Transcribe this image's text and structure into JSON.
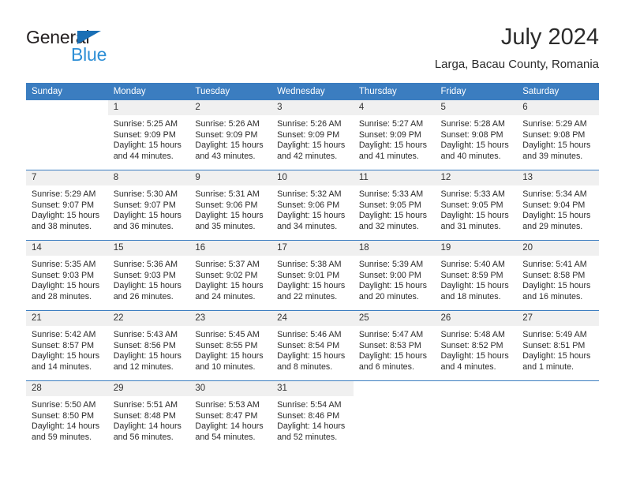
{
  "brand": {
    "word_one": "General",
    "word_two": "Blue",
    "triangle_icon": "brand-triangle-icon",
    "accent_dark": "#1a6fb5",
    "accent_light": "#2e8fd6"
  },
  "header": {
    "title": "July 2024",
    "subtitle": "Larga, Bacau County, Romania"
  },
  "colors": {
    "header_blue": "#3b7dc0",
    "daynum_band": "#f0f0f0",
    "text": "#2b2b2b"
  },
  "weekdays": [
    "Sunday",
    "Monday",
    "Tuesday",
    "Wednesday",
    "Thursday",
    "Friday",
    "Saturday"
  ],
  "weeks": [
    [
      {
        "day": "",
        "empty": true,
        "sunrise": "",
        "sunset": "",
        "daylight_line1": "",
        "daylight_line2": ""
      },
      {
        "day": "1",
        "sunrise": "Sunrise: 5:25 AM",
        "sunset": "Sunset: 9:09 PM",
        "daylight_line1": "Daylight: 15 hours",
        "daylight_line2": "and 44 minutes."
      },
      {
        "day": "2",
        "sunrise": "Sunrise: 5:26 AM",
        "sunset": "Sunset: 9:09 PM",
        "daylight_line1": "Daylight: 15 hours",
        "daylight_line2": "and 43 minutes."
      },
      {
        "day": "3",
        "sunrise": "Sunrise: 5:26 AM",
        "sunset": "Sunset: 9:09 PM",
        "daylight_line1": "Daylight: 15 hours",
        "daylight_line2": "and 42 minutes."
      },
      {
        "day": "4",
        "sunrise": "Sunrise: 5:27 AM",
        "sunset": "Sunset: 9:09 PM",
        "daylight_line1": "Daylight: 15 hours",
        "daylight_line2": "and 41 minutes."
      },
      {
        "day": "5",
        "sunrise": "Sunrise: 5:28 AM",
        "sunset": "Sunset: 9:08 PM",
        "daylight_line1": "Daylight: 15 hours",
        "daylight_line2": "and 40 minutes."
      },
      {
        "day": "6",
        "sunrise": "Sunrise: 5:29 AM",
        "sunset": "Sunset: 9:08 PM",
        "daylight_line1": "Daylight: 15 hours",
        "daylight_line2": "and 39 minutes."
      }
    ],
    [
      {
        "day": "7",
        "sunrise": "Sunrise: 5:29 AM",
        "sunset": "Sunset: 9:07 PM",
        "daylight_line1": "Daylight: 15 hours",
        "daylight_line2": "and 38 minutes."
      },
      {
        "day": "8",
        "sunrise": "Sunrise: 5:30 AM",
        "sunset": "Sunset: 9:07 PM",
        "daylight_line1": "Daylight: 15 hours",
        "daylight_line2": "and 36 minutes."
      },
      {
        "day": "9",
        "sunrise": "Sunrise: 5:31 AM",
        "sunset": "Sunset: 9:06 PM",
        "daylight_line1": "Daylight: 15 hours",
        "daylight_line2": "and 35 minutes."
      },
      {
        "day": "10",
        "sunrise": "Sunrise: 5:32 AM",
        "sunset": "Sunset: 9:06 PM",
        "daylight_line1": "Daylight: 15 hours",
        "daylight_line2": "and 34 minutes."
      },
      {
        "day": "11",
        "sunrise": "Sunrise: 5:33 AM",
        "sunset": "Sunset: 9:05 PM",
        "daylight_line1": "Daylight: 15 hours",
        "daylight_line2": "and 32 minutes."
      },
      {
        "day": "12",
        "sunrise": "Sunrise: 5:33 AM",
        "sunset": "Sunset: 9:05 PM",
        "daylight_line1": "Daylight: 15 hours",
        "daylight_line2": "and 31 minutes."
      },
      {
        "day": "13",
        "sunrise": "Sunrise: 5:34 AM",
        "sunset": "Sunset: 9:04 PM",
        "daylight_line1": "Daylight: 15 hours",
        "daylight_line2": "and 29 minutes."
      }
    ],
    [
      {
        "day": "14",
        "sunrise": "Sunrise: 5:35 AM",
        "sunset": "Sunset: 9:03 PM",
        "daylight_line1": "Daylight: 15 hours",
        "daylight_line2": "and 28 minutes."
      },
      {
        "day": "15",
        "sunrise": "Sunrise: 5:36 AM",
        "sunset": "Sunset: 9:03 PM",
        "daylight_line1": "Daylight: 15 hours",
        "daylight_line2": "and 26 minutes."
      },
      {
        "day": "16",
        "sunrise": "Sunrise: 5:37 AM",
        "sunset": "Sunset: 9:02 PM",
        "daylight_line1": "Daylight: 15 hours",
        "daylight_line2": "and 24 minutes."
      },
      {
        "day": "17",
        "sunrise": "Sunrise: 5:38 AM",
        "sunset": "Sunset: 9:01 PM",
        "daylight_line1": "Daylight: 15 hours",
        "daylight_line2": "and 22 minutes."
      },
      {
        "day": "18",
        "sunrise": "Sunrise: 5:39 AM",
        "sunset": "Sunset: 9:00 PM",
        "daylight_line1": "Daylight: 15 hours",
        "daylight_line2": "and 20 minutes."
      },
      {
        "day": "19",
        "sunrise": "Sunrise: 5:40 AM",
        "sunset": "Sunset: 8:59 PM",
        "daylight_line1": "Daylight: 15 hours",
        "daylight_line2": "and 18 minutes."
      },
      {
        "day": "20",
        "sunrise": "Sunrise: 5:41 AM",
        "sunset": "Sunset: 8:58 PM",
        "daylight_line1": "Daylight: 15 hours",
        "daylight_line2": "and 16 minutes."
      }
    ],
    [
      {
        "day": "21",
        "sunrise": "Sunrise: 5:42 AM",
        "sunset": "Sunset: 8:57 PM",
        "daylight_line1": "Daylight: 15 hours",
        "daylight_line2": "and 14 minutes."
      },
      {
        "day": "22",
        "sunrise": "Sunrise: 5:43 AM",
        "sunset": "Sunset: 8:56 PM",
        "daylight_line1": "Daylight: 15 hours",
        "daylight_line2": "and 12 minutes."
      },
      {
        "day": "23",
        "sunrise": "Sunrise: 5:45 AM",
        "sunset": "Sunset: 8:55 PM",
        "daylight_line1": "Daylight: 15 hours",
        "daylight_line2": "and 10 minutes."
      },
      {
        "day": "24",
        "sunrise": "Sunrise: 5:46 AM",
        "sunset": "Sunset: 8:54 PM",
        "daylight_line1": "Daylight: 15 hours",
        "daylight_line2": "and 8 minutes."
      },
      {
        "day": "25",
        "sunrise": "Sunrise: 5:47 AM",
        "sunset": "Sunset: 8:53 PM",
        "daylight_line1": "Daylight: 15 hours",
        "daylight_line2": "and 6 minutes."
      },
      {
        "day": "26",
        "sunrise": "Sunrise: 5:48 AM",
        "sunset": "Sunset: 8:52 PM",
        "daylight_line1": "Daylight: 15 hours",
        "daylight_line2": "and 4 minutes."
      },
      {
        "day": "27",
        "sunrise": "Sunrise: 5:49 AM",
        "sunset": "Sunset: 8:51 PM",
        "daylight_line1": "Daylight: 15 hours",
        "daylight_line2": "and 1 minute."
      }
    ],
    [
      {
        "day": "28",
        "sunrise": "Sunrise: 5:50 AM",
        "sunset": "Sunset: 8:50 PM",
        "daylight_line1": "Daylight: 14 hours",
        "daylight_line2": "and 59 minutes."
      },
      {
        "day": "29",
        "sunrise": "Sunrise: 5:51 AM",
        "sunset": "Sunset: 8:48 PM",
        "daylight_line1": "Daylight: 14 hours",
        "daylight_line2": "and 56 minutes."
      },
      {
        "day": "30",
        "sunrise": "Sunrise: 5:53 AM",
        "sunset": "Sunset: 8:47 PM",
        "daylight_line1": "Daylight: 14 hours",
        "daylight_line2": "and 54 minutes."
      },
      {
        "day": "31",
        "sunrise": "Sunrise: 5:54 AM",
        "sunset": "Sunset: 8:46 PM",
        "daylight_line1": "Daylight: 14 hours",
        "daylight_line2": "and 52 minutes."
      },
      {
        "day": "",
        "empty": true,
        "sunrise": "",
        "sunset": "",
        "daylight_line1": "",
        "daylight_line2": ""
      },
      {
        "day": "",
        "empty": true,
        "sunrise": "",
        "sunset": "",
        "daylight_line1": "",
        "daylight_line2": ""
      },
      {
        "day": "",
        "empty": true,
        "sunrise": "",
        "sunset": "",
        "daylight_line1": "",
        "daylight_line2": ""
      }
    ]
  ]
}
